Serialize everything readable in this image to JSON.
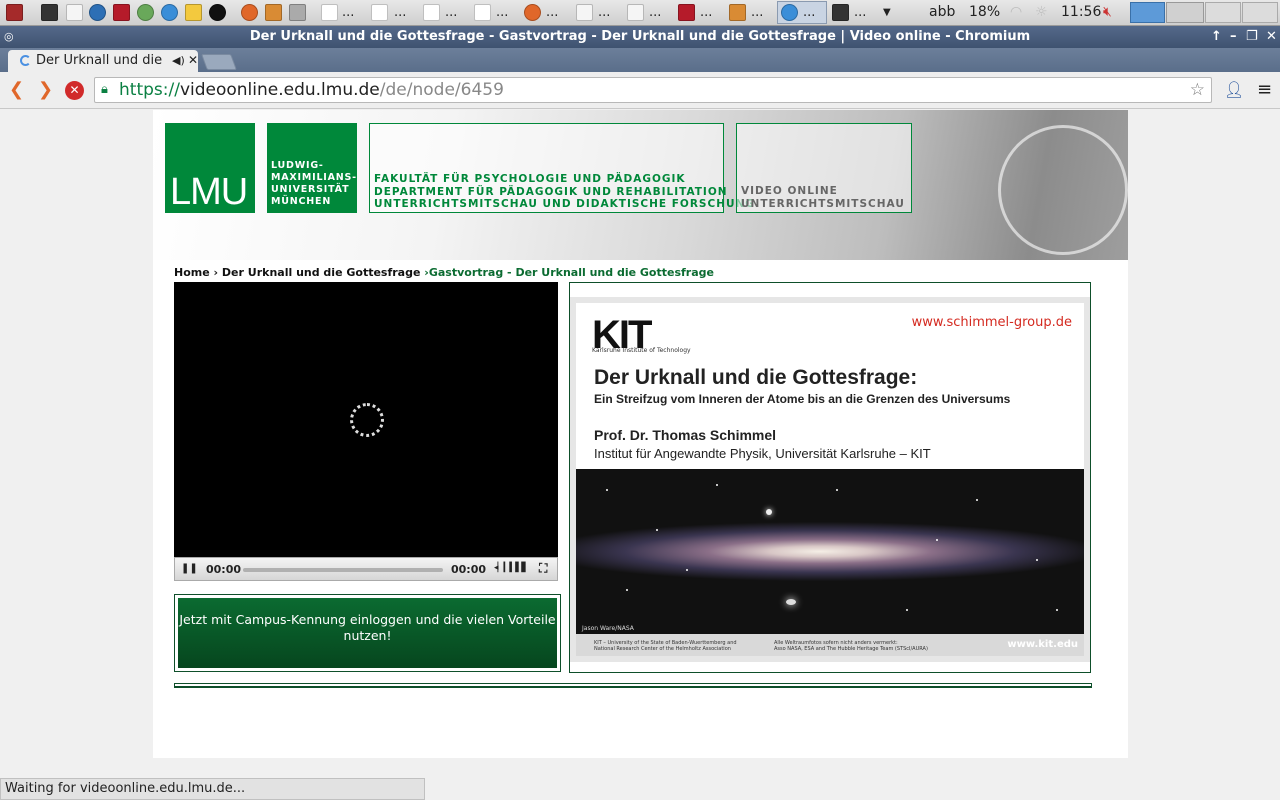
{
  "taskbar": {
    "dots": "...",
    "keyboard_layout": "abb",
    "battery": "18%",
    "clock": "11:56"
  },
  "window": {
    "title": "Der Urknall und die Gottesfrage - Gastvortrag - Der Urknall und die Gottesfrage | Video online - Chromium"
  },
  "tab": {
    "title": "Der Urknall und die Gottesfrage - Gastvortrag - Der Urknall und die Gottesfrage | Video online"
  },
  "omnibox": {
    "scheme": "https://",
    "host": "videoonline.edu.lmu.de",
    "path": "/de/node/6459"
  },
  "header": {
    "logo_text": "LMU",
    "university_lines": [
      "LUDWIG-",
      "MAXIMILIANS-",
      "UNIVERSITÄT",
      "MÜNCHEN"
    ],
    "faculty_lines": [
      "FAKULTÄT FÜR PSYCHOLOGIE UND PÄDAGOGIK",
      "DEPARTMENT FÜR PÄDAGOGIK UND REHABILITATION",
      "UNTERRICHTSMITSCHAU UND DIDAKTISCHE FORSCHUNG"
    ],
    "service_lines": [
      "VIDEO ONLINE",
      "UNTERRICHTSMITSCHAU"
    ]
  },
  "breadcrumb": {
    "home": "Home",
    "sep": "›",
    "item1": "Der Urknall und die Gottesfrage",
    "current": "›Gastvortrag - Der Urknall und die Gottesfrage"
  },
  "player": {
    "time_current": "00:00",
    "time_total": "00:00"
  },
  "login_button": "Jetzt mit Campus-Kennung einloggen und die vielen Vorteile nutzen!",
  "slide": {
    "logo": "KIT",
    "logo_sub": "Karlsruhe Institute of Technology",
    "website": "www.schimmel-group.de",
    "title": "Der Urknall und die Gottesfrage:",
    "subtitle": "Ein Streifzug vom Inneren der Atome bis an die Grenzen des Universums",
    "author": "Prof. Dr. Thomas Schimmel",
    "institute": "Institut für Angewandte Physik, Universität Karlsruhe – KIT",
    "image_credit": "Jason Ware/NASA",
    "footer_left_1": "KIT – University of the State of Baden-Wuerttemberg and",
    "footer_left_2": "National Research Center of the Helmholtz Association",
    "footer_mid_1": "Alle Weltraumfotos sofern nicht anders vermerkt:",
    "footer_mid_2": "Asso NASA, ESA and The Hubble Heritage Team (STScI/AURA)",
    "footer_right": "www.kit.edu"
  },
  "status_bar": "Waiting for videoonline.edu.lmu.de...",
  "colors": {
    "lmu_green": "#00883a",
    "dark_green": "#0e4f2a",
    "slide_red": "#d42a20"
  }
}
